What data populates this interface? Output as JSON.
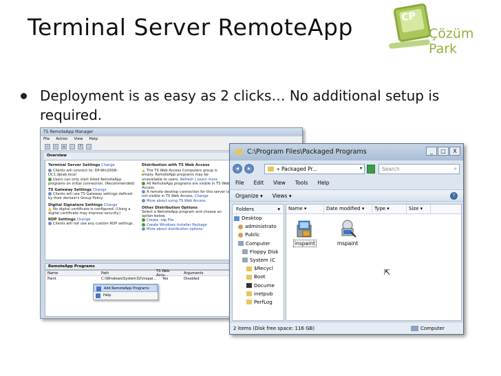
{
  "slide": {
    "title": "Terminal Server RemoteApp",
    "bullet": "Deployment is as easy as 2 clicks… No additional setup is required."
  },
  "logo": {
    "monogram": "CP",
    "name": "Çözüm Park",
    "color": "#8db33d"
  },
  "manager": {
    "title": "TS RemoteApp Manager",
    "menu": [
      "File",
      "Action",
      "View",
      "Help"
    ],
    "overview": "Overview",
    "ts_settings": {
      "label": "Terminal Server Settings",
      "change": "Change",
      "text": "Clients will connect to: DP-Win2008-DC1.dpiab.local",
      "text2": "Users can only start listed RemoteApp programs on initial connection. (Recommended)"
    },
    "gateway": {
      "label": "TS Gateway Settings",
      "change": "Change",
      "text": "Clients will use TS Gateway settings defined by their domain's Group Policy."
    },
    "signature": {
      "label": "Digital Signature Settings",
      "change": "Change",
      "text": "No digital certificate is configured. (Using a digital certificate may improve security.)"
    },
    "rdp": {
      "label": "RDP Settings",
      "change": "Change",
      "text": "Clients will not use any custom RDP settings."
    },
    "distribution": {
      "label": "Distribution with TS Web Access",
      "text": "The TS Web Access Computers group is empty. RemoteApp programs may be unavailable to users.",
      "refresh": "Refresh",
      "learn": "Learn more",
      "text2": "All RemoteApp programs are visible in TS Web Access.",
      "text3": "A remote desktop connection for this server is not visible in TS Web Access.",
      "change": "Change",
      "more": "More about using TS Web Access"
    },
    "other": {
      "label": "Other Distribution Options",
      "text": "Select a RemoteApp program and choose an option below.",
      "rdp_file": "Create .rdp File",
      "msi": "Create Windows Installer Package",
      "more": "More about distribution options"
    },
    "programs_head": "RemoteApp Programs",
    "columns": [
      "Name",
      "Path",
      "TS Web Acce...",
      "Arguments"
    ],
    "row": [
      "Paint",
      "C:\\Windows\\System32\\mspai...",
      "Yes",
      "Disabled"
    ],
    "context_menu": [
      "Add RemoteApp Programs",
      "Help"
    ]
  },
  "explorer": {
    "title": "C:\\Program Files\\Packaged Programs",
    "address": "« Packaged Pr...",
    "search_placeholder": "Search",
    "menu": [
      "File",
      "Edit",
      "View",
      "Tools",
      "Help"
    ],
    "commands": [
      "Organize ▾",
      "Views ▾"
    ],
    "help_glyph": "?",
    "folders_head": "Folders",
    "folders": [
      {
        "label": "Desktop",
        "icon": "desk"
      },
      {
        "label": "administrato",
        "icon": "user"
      },
      {
        "label": "Public",
        "icon": "user"
      },
      {
        "label": "Computer",
        "icon": "comp"
      },
      {
        "label": "Floppy Disk",
        "icon": "drive"
      },
      {
        "label": "System (C",
        "icon": "drive"
      },
      {
        "label": "$Recycl",
        "icon": "folder"
      },
      {
        "label": "Boot",
        "icon": "folder"
      },
      {
        "label": "Docume",
        "icon": "blk"
      },
      {
        "label": "inetpub",
        "icon": "folder"
      },
      {
        "label": "PerfLog",
        "icon": "folder"
      }
    ],
    "columns": [
      "Name ▾",
      "Date modified ▾",
      "Type ▾",
      "Size ▾"
    ],
    "files": [
      "inspaint",
      "mspaint"
    ],
    "status": "2 items (Disk free space: 116 GB)",
    "status_computer": "Computer",
    "controls": [
      "_",
      "□",
      "X"
    ]
  }
}
